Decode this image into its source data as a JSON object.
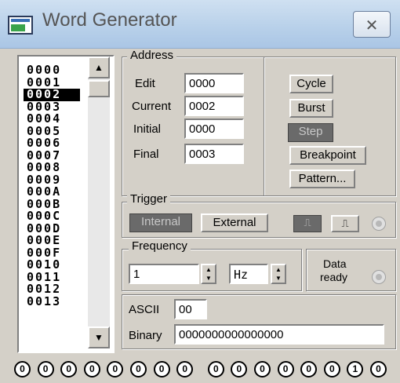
{
  "window": {
    "title": "Word Generator",
    "close_glyph": "✕"
  },
  "words": [
    "0000",
    "0001",
    "0002",
    "0003",
    "0004",
    "0005",
    "0006",
    "0007",
    "0008",
    "0009",
    "000A",
    "000B",
    "000C",
    "000D",
    "000E",
    "000F",
    "0010",
    "0011",
    "0012",
    "0013"
  ],
  "selected_word_index": 2,
  "address": {
    "group_label": "Address",
    "edit_label": "Edit",
    "edit_value": "0000",
    "current_label": "Current",
    "current_value": "0002",
    "initial_label": "Initial",
    "initial_value": "0000",
    "final_label": "Final",
    "final_value": "0003"
  },
  "mode_buttons": {
    "cycle": "Cycle",
    "burst": "Burst",
    "step": "Step",
    "breakpoint": "Breakpoint",
    "pattern": "Pattern..."
  },
  "trigger": {
    "group_label": "Trigger",
    "internal": "Internal",
    "external": "External"
  },
  "frequency": {
    "group_label": "Frequency",
    "value": "1",
    "unit": "Hz"
  },
  "data_ready": {
    "line1": "Data",
    "line2": "ready"
  },
  "ascii": {
    "label": "ASCII",
    "value": "00"
  },
  "binary": {
    "label": "Binary",
    "value": "0000000000000000"
  },
  "bits": [
    "0",
    "0",
    "0",
    "0",
    "0",
    "0",
    "0",
    "0",
    "0",
    "0",
    "0",
    "0",
    "0",
    "0",
    "1",
    "0"
  ]
}
